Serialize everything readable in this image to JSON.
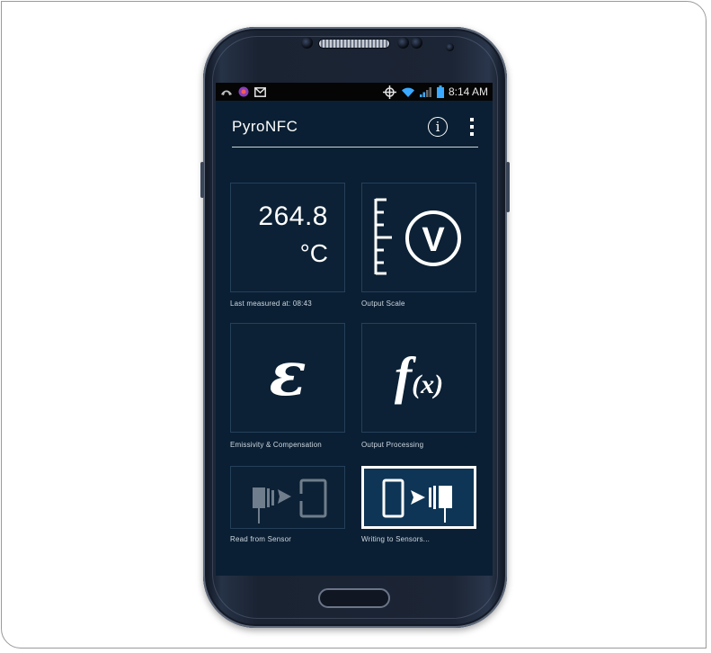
{
  "status_bar": {
    "time": "8:14 AM"
  },
  "app": {
    "title": "PyroNFC",
    "info_icon_glyph": "i"
  },
  "tiles": {
    "temperature": {
      "value": "264.8",
      "unit": "°C",
      "label": "Last measured at: 08:43"
    },
    "output_scale": {
      "glyph": "V",
      "label": "Output Scale"
    },
    "emissivity": {
      "glyph": "ε",
      "label": "Emissivity & Compensation"
    },
    "output_processing": {
      "glyph": "f",
      "glyph_arg": "(x)",
      "label": "Output Processing"
    },
    "read_sensor": {
      "label": "Read from Sensor"
    },
    "write_sensor": {
      "label": "Writing to Sensors..."
    }
  },
  "colors": {
    "screen_bg": "#0a1f33",
    "tile_bg": "#0c2135",
    "tile_border": "#25405a",
    "selected_tile_bg": "#0e3555",
    "battery": "#3aa9ff"
  }
}
